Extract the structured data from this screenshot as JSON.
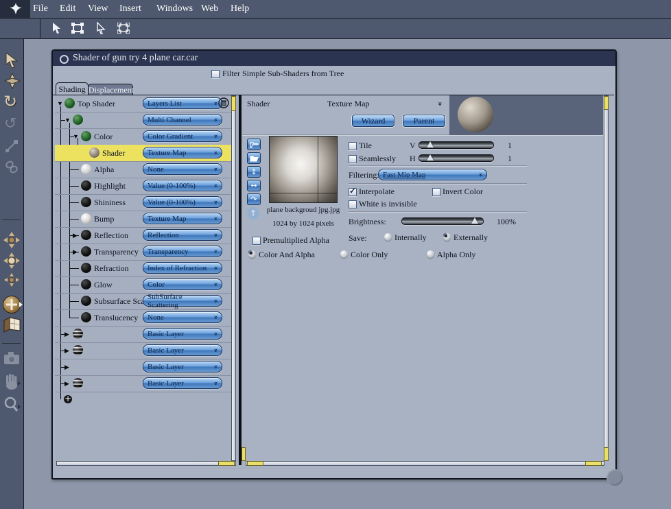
{
  "menu": {
    "items": [
      "File",
      "Edit",
      "View",
      "Insert",
      "Windows",
      "Web",
      "Help"
    ]
  },
  "window": {
    "title": "Shader of gun try 4 plane car.car",
    "filter_label": "Filter Simple Sub-Shaders from Tree",
    "filter_checked": false
  },
  "tabs": [
    {
      "label": "Shading",
      "active": true
    },
    {
      "label": "Displacement",
      "active": false
    }
  ],
  "tree": {
    "items": [
      {
        "label": "Top Shader",
        "dropdown": "Layers List",
        "sphere": "green",
        "level": 0,
        "expander": "down",
        "trash": true
      },
      {
        "label": "",
        "dropdown": "Multi Channel",
        "sphere": "green",
        "level": 1,
        "expander": "down"
      },
      {
        "label": "Color",
        "dropdown": "Color Gradient",
        "sphere": "green",
        "level": 2,
        "expander": "down"
      },
      {
        "label": "Shader",
        "dropdown": "Texture Map",
        "sphere": "texture",
        "level": 3,
        "highlight": true
      },
      {
        "label": "Alpha",
        "dropdown": "None",
        "sphere": "white",
        "level": 2
      },
      {
        "label": "Highlight",
        "dropdown": "Value (0-100%)",
        "sphere": "black",
        "level": 2
      },
      {
        "label": "Shininess",
        "dropdown": "Value (0-100%)",
        "sphere": "black",
        "level": 2
      },
      {
        "label": "Bump",
        "dropdown": "Texture Map",
        "sphere": "bump",
        "level": 2
      },
      {
        "label": "Reflection",
        "dropdown": "Reflection",
        "sphere": "black",
        "level": 2,
        "expander": "right"
      },
      {
        "label": "Transparency",
        "dropdown": "Transparency",
        "sphere": "black",
        "level": 2,
        "expander": "right"
      },
      {
        "label": "Refraction",
        "dropdown": "Index of Refraction",
        "sphere": "black",
        "level": 2
      },
      {
        "label": "Glow",
        "dropdown": "Color",
        "sphere": "black",
        "level": 2
      },
      {
        "label": "Subsurface Scat",
        "dropdown": "SubSurface Scattering",
        "sphere": "black",
        "level": 2
      },
      {
        "label": "Translucency",
        "dropdown": "None",
        "sphere": "black",
        "level": 2
      },
      {
        "label": "",
        "dropdown": "Basic Layer",
        "sphere": "stripe",
        "level": 1,
        "expander": "right"
      },
      {
        "label": "",
        "dropdown": "Basic Layer",
        "sphere": "stripe",
        "level": 1,
        "expander": "right"
      },
      {
        "label": "",
        "dropdown": "Basic Layer",
        "sphere": "none",
        "level": 1,
        "expander": "right"
      },
      {
        "label": "",
        "dropdown": "Basic Layer",
        "sphere": "stripe",
        "level": 1,
        "expander": "right"
      }
    ]
  },
  "detail": {
    "header_label": "Shader",
    "header_type": "Texture Map",
    "wizard_label": "Wizard",
    "parent_label": "Parent",
    "tile_label": "Tile",
    "seamlessly_label": "Seamlessly",
    "v_label": "V",
    "h_label": "H",
    "v_value": "1",
    "h_value": "1",
    "filtering_label": "Filtering:",
    "filtering_value": "Fast Mip Map",
    "interpolate_label": "Interpolate",
    "invert_label": "Invert Color",
    "white_invisible_label": "White is invisible",
    "brightness_label": "Brightness:",
    "brightness_value": "100%",
    "save_label": "Save:",
    "internally_label": "Internally",
    "externally_label": "Externally",
    "filename": "plane backgroud jpg.jpg",
    "dimensions": "1024 by 1024 pixels",
    "premultiplied_label": "Premultiplied Alpha",
    "color_and_alpha_label": "Color And Alpha",
    "color_only_label": "Color Only",
    "alpha_only_label": "Alpha Only",
    "states": {
      "tile": false,
      "seamlessly": false,
      "interpolate": true,
      "invert_color": false,
      "white_is_invisible": false,
      "premultiplied_alpha": false,
      "save": "Externally",
      "channel_mode": "Color And Alpha"
    }
  }
}
